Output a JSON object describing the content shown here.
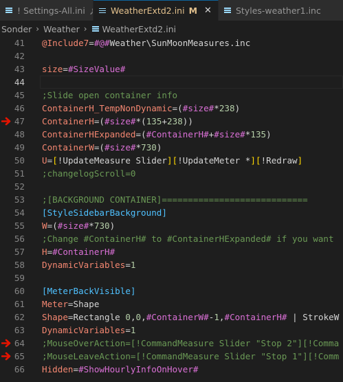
{
  "tabs": [
    {
      "label": "! Settings-All.ini",
      "pinned": true
    },
    {
      "label": "WeatherExtd2.ini",
      "modified_badge": "M",
      "active": true
    },
    {
      "label": "Styles-weather1.inc"
    }
  ],
  "breadcrumb": [
    "Sonder",
    "Weather",
    "WeatherExtd2.ini"
  ],
  "colors": {
    "active_tab_text": "#e2c08d",
    "background": "#1e1e1e",
    "arrow": "#e51400"
  },
  "editor": {
    "current_line": 44,
    "marked_lines": [
      47,
      64,
      65
    ],
    "lines": [
      {
        "n": "41",
        "text": "@Include7=#@#Weather\\SunMoonMeasures.inc"
      },
      {
        "n": "42",
        "text": ""
      },
      {
        "n": "43",
        "text": "size=#SizeValue#"
      },
      {
        "n": "44",
        "text": ""
      },
      {
        "n": "45",
        "text": ";Slide open container info"
      },
      {
        "n": "46",
        "text": "ContainerH_TempNonDynamic=(#size#*238)"
      },
      {
        "n": "47",
        "text": "ContainerH=(#size#*(135+238))"
      },
      {
        "n": "48",
        "text": "ContainerHExpanded=(#ContainerH#+#size#*135)"
      },
      {
        "n": "49",
        "text": "ContainerW=(#size#*730)"
      },
      {
        "n": "50",
        "text": "U=[!UpdateMeasure Slider][!UpdateMeter *][!Redraw]"
      },
      {
        "n": "51",
        "text": ";changelogScroll=0"
      },
      {
        "n": "52",
        "text": ""
      },
      {
        "n": "53",
        "text": ";[BACKGROUND CONTAINER]============================"
      },
      {
        "n": "54",
        "text": "[StyleSidebarBackground]"
      },
      {
        "n": "55",
        "text": "W=(#size#*730)"
      },
      {
        "n": "56",
        "text": ";Change #ContainerH# to #ContainerHExpanded# if you want"
      },
      {
        "n": "57",
        "text": "H=#ContainerH#"
      },
      {
        "n": "58",
        "text": "DynamicVariables=1"
      },
      {
        "n": "59",
        "text": ""
      },
      {
        "n": "60",
        "text": "[MeterBackVisible]"
      },
      {
        "n": "61",
        "text": "Meter=Shape"
      },
      {
        "n": "62",
        "text": "Shape=Rectangle 0,0,#ContainerW#-1,#ContainerH# | StrokeW"
      },
      {
        "n": "63",
        "text": "DynamicVariables=1"
      },
      {
        "n": "64",
        "text": ";MouseOverAction=[!CommandMeasure Slider \"Stop 2\"][!Comma"
      },
      {
        "n": "65",
        "text": ";MouseLeaveAction=[!CommandMeasure Slider \"Stop 1\"][!Comm"
      },
      {
        "n": "66",
        "text": "Hidden=#ShowHourlyInfoOnHover#"
      }
    ]
  }
}
